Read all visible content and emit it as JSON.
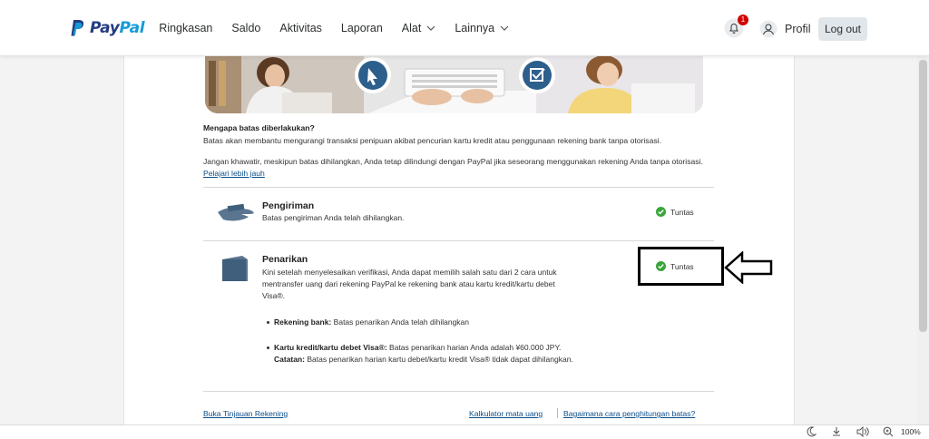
{
  "header": {
    "logo_pay": "Pay",
    "logo_pal": "Pal",
    "nav": [
      {
        "label": "Ringkasan"
      },
      {
        "label": "Saldo"
      },
      {
        "label": "Aktivitas"
      },
      {
        "label": "Laporan"
      },
      {
        "label": "Alat"
      },
      {
        "label": "Lainnya"
      }
    ],
    "notification_count": "1",
    "profile_label": "Profil",
    "logout_label": "Log out"
  },
  "content": {
    "why_heading": "Mengapa batas diberlakukan?",
    "why_text": "Batas akan membantu mengurangi transaksi penipuan akibat pencurian kartu kredit atau penggunaan rekening bank tanpa otorisasi.",
    "dont_worry_text": "Jangan khawatir, meskipun batas dihilangkan, Anda tetap dilindungi dengan PayPal jika seseorang menggunakan rekening Anda tanpa otorisasi.",
    "learn_more": "Pelajari lebih jauh",
    "items": [
      {
        "title": "Pengiriman",
        "text": "Batas pengiriman Anda telah dihilangkan.",
        "status": "Tuntas"
      },
      {
        "title": "Penarikan",
        "text_line1": "Kini setelah menyelesaikan verifikasi, Anda dapat memilih salah satu dari 2 cara untuk",
        "text_line2": "mentransfer uang dari rekening PayPal ke rekening bank atau kartu kredit/kartu debet",
        "text_line3": "Visa®.",
        "status": "Tuntas",
        "bullets": [
          {
            "label": "Rekening bank:",
            "text": "Batas penarikan Anda telah dihilangkan"
          },
          {
            "label": "Kartu kredit/kartu debet Visa®:",
            "text": "Batas penarikan harian Anda adalah ¥60.000 JPY.",
            "note_label": "Catatan:",
            "note_text": "Batas penarikan harian kartu debet/kartu kredit Visa® tidak dapat dihilangkan."
          }
        ]
      }
    ]
  },
  "footer": {
    "account_overview": "Buka Tinjauan Rekening",
    "currency_calc": "Kalkulator mata uang",
    "how_limits": "Bagaimana cara penghitungan batas?"
  },
  "statusbar": {
    "zoom": "100%"
  },
  "colors": {
    "paypal_dark": "#253b80",
    "paypal_light": "#179bd7",
    "link": "#0b4f8a",
    "check_green": "#3aa53a",
    "badge_red": "#d20000"
  }
}
